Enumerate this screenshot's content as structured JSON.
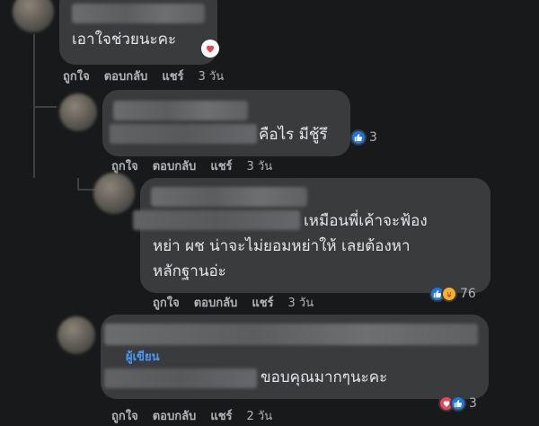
{
  "comments": [
    {
      "text": "เอาใจช่วยนะคะ",
      "actions": {
        "like": "ถูกใจ",
        "reply": "ตอบกลับ",
        "share": "แชร์",
        "time": "3 วัน"
      }
    },
    {
      "text": "คือไร มีชู้รึ",
      "reaction_count": "3",
      "actions": {
        "like": "ถูกใจ",
        "reply": "ตอบกลับ",
        "share": "แชร์",
        "time": "3 วัน"
      }
    },
    {
      "lines": [
        "เหมือนพี่เค้าจะฟ้อง",
        "หย่า ผช น่าจะไม่ยอมหย่าให้ เลยต้องหา",
        "หลักฐานอ่ะ"
      ],
      "reaction_count": "76",
      "actions": {
        "like": "ถูกใจ",
        "reply": "ตอบกลับ",
        "share": "แชร์",
        "time": "3 วัน"
      }
    },
    {
      "author_badge": "ผู้เขียน",
      "text": "ขอบคุณมากๆนะคะ",
      "reaction_count": "3",
      "actions": {
        "like": "ถูกใจ",
        "reply": "ตอบกลับ",
        "share": "แชร์",
        "time": "2 วัน"
      }
    }
  ],
  "icons": {
    "like": "like-icon",
    "love": "love-icon",
    "care": "care-icon",
    "heart": "heart-icon"
  },
  "colors": {
    "background": "#18191a",
    "bubble": "#3a3b3c",
    "text": "#e4e6eb",
    "meta": "#b0b3b8",
    "author": "#4599ff",
    "like": "#1877f2",
    "love": "#f33e58"
  }
}
